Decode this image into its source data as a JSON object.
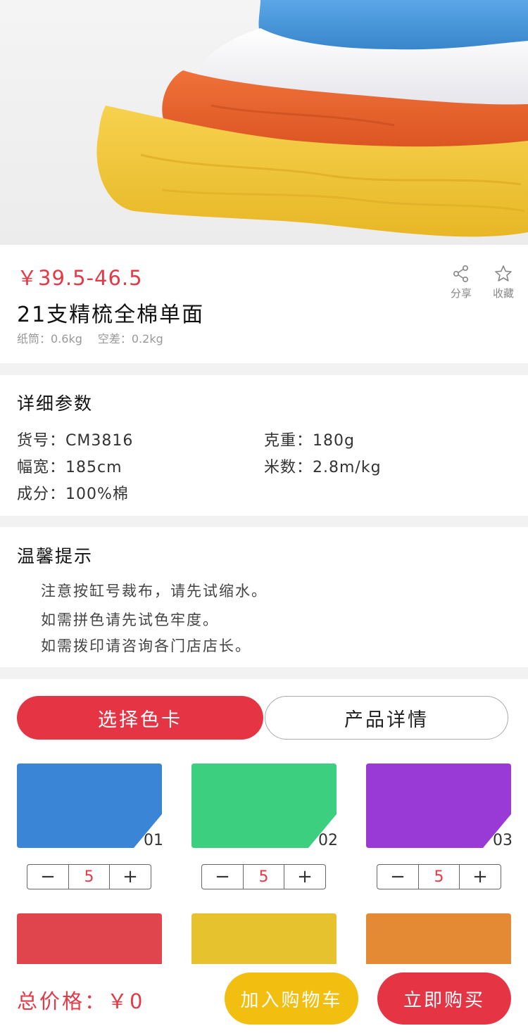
{
  "product": {
    "price": "￥39.5-46.5",
    "title": "21支精梳全棉单面",
    "tube_weight": "纸筒：0.6kg",
    "empty_diff": "空差：0.2kg",
    "hero_colors": [
      "#3f8fd4",
      "#ffffff",
      "#e8602a",
      "#f2c73a"
    ]
  },
  "actions": {
    "share_label": "分享",
    "favorite_label": "收藏"
  },
  "params": {
    "section_title": "详细参数",
    "item_no": "货号：CM3816",
    "weight": "克重：180g",
    "width": "幅宽：185cm",
    "meters": "米数：2.8m/kg",
    "composition": "成分：100%棉"
  },
  "tips": {
    "section_title": "温馨提示",
    "lines": [
      "注意按缸号裁布，请先试缩水。",
      "如需拼色请先试色牢度。",
      "如需拨印请咨询各门店店长。"
    ]
  },
  "tabs": {
    "active_label": "选择色卡",
    "inactive_label": "产品详情"
  },
  "swatches": [
    {
      "number": "01",
      "color": "#3a85d6",
      "quantity": "5"
    },
    {
      "number": "02",
      "color": "#3ccf80",
      "quantity": "5"
    },
    {
      "number": "03",
      "color": "#9a3ad6",
      "quantity": "5"
    },
    {
      "number": "",
      "color": "#e0444c",
      "quantity": ""
    },
    {
      "number": "",
      "color": "#e6c22e",
      "quantity": ""
    },
    {
      "number": "",
      "color": "#e58a34",
      "quantity": ""
    }
  ],
  "stepper": {
    "minus_symbol": "−",
    "plus_symbol": "+"
  },
  "footer": {
    "total_label": "总价格：￥0",
    "cart_label": "加入购物车",
    "buy_label": "立即购买"
  },
  "colors": {
    "accent_red": "#e53545",
    "accent_yellow": "#f2be0f"
  }
}
